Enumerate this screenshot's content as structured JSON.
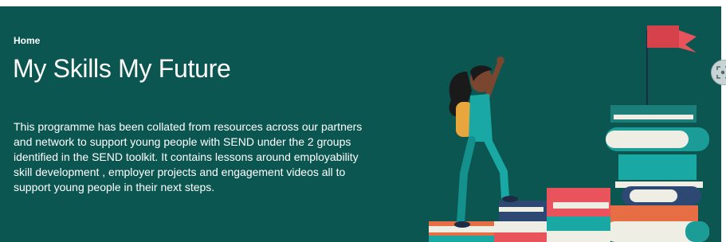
{
  "breadcrumb": {
    "home_label": "Home"
  },
  "hero": {
    "title": "My Skills My Future",
    "description": "This programme has been collated from resources across our partners and network to support young people with SEND under the 2 groups identified in the SEND toolkit. It contains lessons around employability skill development , employer projects and engagement videos all to support young people in their next steps."
  },
  "colors": {
    "hero_background": "#0b5650",
    "flag": "#e8535c",
    "teal": "#19a8a3",
    "navy": "#2e4874",
    "orange": "#e66d44",
    "cream": "#efeee4"
  },
  "icons": {
    "side_button": "scan-icon"
  }
}
